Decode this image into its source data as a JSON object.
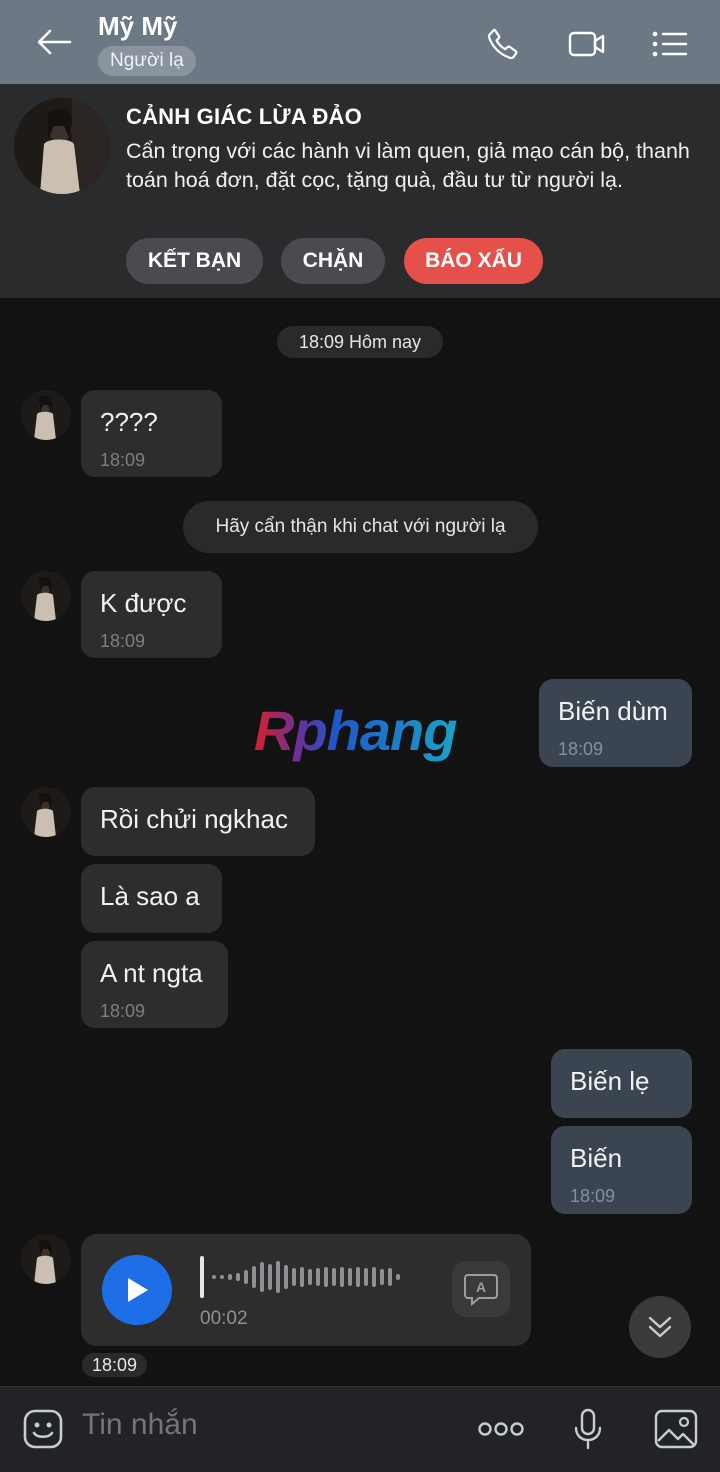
{
  "header": {
    "title": "Mỹ Mỹ",
    "subtitle": "Người lạ",
    "icons": [
      "back-arrow-icon",
      "phone-icon",
      "video-icon",
      "menu-list-icon"
    ]
  },
  "warning": {
    "title": "CẢNH GIÁC LỪA ĐẢO",
    "text": "Cẩn trọng với các hành vi làm quen, giả mạo cán bộ, thanh toán hoá đơn, đặt cọc, tặng quà, đầu tư từ người lạ.",
    "buttons": {
      "add_friend": "KẾT BẠN",
      "block": "CHẶN",
      "report": "BÁO XẤU"
    }
  },
  "chat": {
    "date_chip": "18:09 Hôm nay",
    "stranger_notice": "Hãy cẩn thận khi chat với người lạ",
    "messages": [
      {
        "text": "????",
        "time": "18:09"
      },
      {
        "text": "K được",
        "time": "18:09"
      },
      {
        "text": "Biến dùm",
        "time": "18:09"
      },
      {
        "text": "Rồi chửi ngkhac",
        "time": ""
      },
      {
        "text": "Là sao a",
        "time": ""
      },
      {
        "text": "A nt ngta",
        "time": "18:09"
      },
      {
        "text": "Biến lẹ",
        "time": ""
      },
      {
        "text": "Biến",
        "time": "18:09"
      }
    ],
    "voice": {
      "duration": "00:02",
      "time": "18:09"
    }
  },
  "watermark": "Rphang",
  "input": {
    "placeholder": "Tin nhắn"
  },
  "colors": {
    "header": "#6c7884",
    "report_button": "#e5504b",
    "play_button": "#1e6ee8",
    "my_bubble": "#3b4552"
  }
}
